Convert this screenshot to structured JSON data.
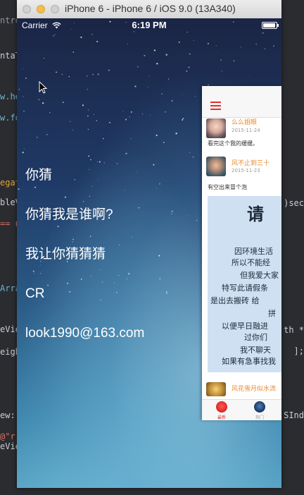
{
  "window": {
    "title": "iPhone 6 - iPhone 6 / iOS 9.0 (13A340)"
  },
  "code_fragments": {
    "left": [
      "ntroll",
      "ntaTi",
      "w.he",
      "w.fo",
      "egat",
      "bleVi",
      "== n",
      "Arra",
      "eVie",
      "eigh",
      "ew:(",
      "@\"r",
      "eVie"
    ],
    "right": [
      ")sec",
      "th *",
      "];",
      "SInd"
    ]
  },
  "status_bar": {
    "carrier": "Carrier",
    "time": "6:19 PM",
    "battery_level": 0.95
  },
  "side_menu": {
    "items": [
      "你猜",
      "你猜我是谁啊?",
      "我让你猜猜猜",
      "CR",
      "look1990@163.com"
    ]
  },
  "panel": {
    "posts": [
      {
        "user": "么么姐眼",
        "date": "2015-11-24",
        "text": "看完这个我的缓缓。"
      },
      {
        "user": "风不止到三十",
        "date": "2015-11-23",
        "text": "有空出来冒个泡"
      },
      {
        "user": "风花雪月似水流"
      }
    ],
    "image_text": {
      "title": "请",
      "lines": [
        "因环境生活",
        "所以不能经",
        "但我爱大家",
        "特写此请假条",
        "是出去搬砖  给",
        "拼",
        "以便早日融进",
        "过你们",
        "我不聊天",
        "如果有急事找我"
      ]
    },
    "tabs": [
      {
        "label": "最新",
        "color": "#e3302f"
      },
      {
        "label": "热门",
        "color": "#999999"
      }
    ]
  },
  "colors": {
    "accent": "#e3302f",
    "username": "#e8892a"
  }
}
